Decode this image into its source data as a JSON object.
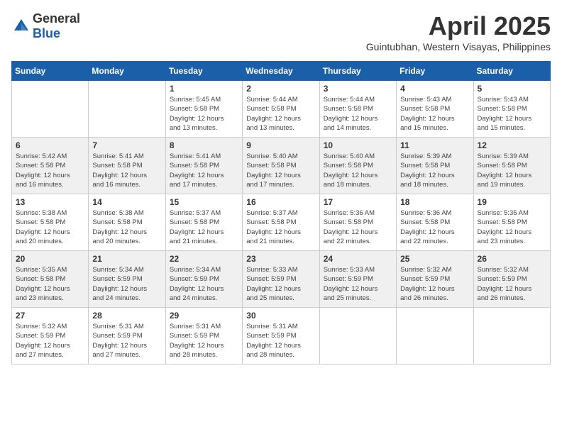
{
  "header": {
    "logo_general": "General",
    "logo_blue": "Blue",
    "month_title": "April 2025",
    "location": "Guintubhan, Western Visayas, Philippines"
  },
  "weekdays": [
    "Sunday",
    "Monday",
    "Tuesday",
    "Wednesday",
    "Thursday",
    "Friday",
    "Saturday"
  ],
  "weeks": [
    [
      {
        "day": "",
        "info": ""
      },
      {
        "day": "",
        "info": ""
      },
      {
        "day": "1",
        "info": "Sunrise: 5:45 AM\nSunset: 5:58 PM\nDaylight: 12 hours\nand 13 minutes."
      },
      {
        "day": "2",
        "info": "Sunrise: 5:44 AM\nSunset: 5:58 PM\nDaylight: 12 hours\nand 13 minutes."
      },
      {
        "day": "3",
        "info": "Sunrise: 5:44 AM\nSunset: 5:58 PM\nDaylight: 12 hours\nand 14 minutes."
      },
      {
        "day": "4",
        "info": "Sunrise: 5:43 AM\nSunset: 5:58 PM\nDaylight: 12 hours\nand 15 minutes."
      },
      {
        "day": "5",
        "info": "Sunrise: 5:43 AM\nSunset: 5:58 PM\nDaylight: 12 hours\nand 15 minutes."
      }
    ],
    [
      {
        "day": "6",
        "info": "Sunrise: 5:42 AM\nSunset: 5:58 PM\nDaylight: 12 hours\nand 16 minutes."
      },
      {
        "day": "7",
        "info": "Sunrise: 5:41 AM\nSunset: 5:58 PM\nDaylight: 12 hours\nand 16 minutes."
      },
      {
        "day": "8",
        "info": "Sunrise: 5:41 AM\nSunset: 5:58 PM\nDaylight: 12 hours\nand 17 minutes."
      },
      {
        "day": "9",
        "info": "Sunrise: 5:40 AM\nSunset: 5:58 PM\nDaylight: 12 hours\nand 17 minutes."
      },
      {
        "day": "10",
        "info": "Sunrise: 5:40 AM\nSunset: 5:58 PM\nDaylight: 12 hours\nand 18 minutes."
      },
      {
        "day": "11",
        "info": "Sunrise: 5:39 AM\nSunset: 5:58 PM\nDaylight: 12 hours\nand 18 minutes."
      },
      {
        "day": "12",
        "info": "Sunrise: 5:39 AM\nSunset: 5:58 PM\nDaylight: 12 hours\nand 19 minutes."
      }
    ],
    [
      {
        "day": "13",
        "info": "Sunrise: 5:38 AM\nSunset: 5:58 PM\nDaylight: 12 hours\nand 20 minutes."
      },
      {
        "day": "14",
        "info": "Sunrise: 5:38 AM\nSunset: 5:58 PM\nDaylight: 12 hours\nand 20 minutes."
      },
      {
        "day": "15",
        "info": "Sunrise: 5:37 AM\nSunset: 5:58 PM\nDaylight: 12 hours\nand 21 minutes."
      },
      {
        "day": "16",
        "info": "Sunrise: 5:37 AM\nSunset: 5:58 PM\nDaylight: 12 hours\nand 21 minutes."
      },
      {
        "day": "17",
        "info": "Sunrise: 5:36 AM\nSunset: 5:58 PM\nDaylight: 12 hours\nand 22 minutes."
      },
      {
        "day": "18",
        "info": "Sunrise: 5:36 AM\nSunset: 5:58 PM\nDaylight: 12 hours\nand 22 minutes."
      },
      {
        "day": "19",
        "info": "Sunrise: 5:35 AM\nSunset: 5:58 PM\nDaylight: 12 hours\nand 23 minutes."
      }
    ],
    [
      {
        "day": "20",
        "info": "Sunrise: 5:35 AM\nSunset: 5:58 PM\nDaylight: 12 hours\nand 23 minutes."
      },
      {
        "day": "21",
        "info": "Sunrise: 5:34 AM\nSunset: 5:59 PM\nDaylight: 12 hours\nand 24 minutes."
      },
      {
        "day": "22",
        "info": "Sunrise: 5:34 AM\nSunset: 5:59 PM\nDaylight: 12 hours\nand 24 minutes."
      },
      {
        "day": "23",
        "info": "Sunrise: 5:33 AM\nSunset: 5:59 PM\nDaylight: 12 hours\nand 25 minutes."
      },
      {
        "day": "24",
        "info": "Sunrise: 5:33 AM\nSunset: 5:59 PM\nDaylight: 12 hours\nand 25 minutes."
      },
      {
        "day": "25",
        "info": "Sunrise: 5:32 AM\nSunset: 5:59 PM\nDaylight: 12 hours\nand 26 minutes."
      },
      {
        "day": "26",
        "info": "Sunrise: 5:32 AM\nSunset: 5:59 PM\nDaylight: 12 hours\nand 26 minutes."
      }
    ],
    [
      {
        "day": "27",
        "info": "Sunrise: 5:32 AM\nSunset: 5:59 PM\nDaylight: 12 hours\nand 27 minutes."
      },
      {
        "day": "28",
        "info": "Sunrise: 5:31 AM\nSunset: 5:59 PM\nDaylight: 12 hours\nand 27 minutes."
      },
      {
        "day": "29",
        "info": "Sunrise: 5:31 AM\nSunset: 5:59 PM\nDaylight: 12 hours\nand 28 minutes."
      },
      {
        "day": "30",
        "info": "Sunrise: 5:31 AM\nSunset: 5:59 PM\nDaylight: 12 hours\nand 28 minutes."
      },
      {
        "day": "",
        "info": ""
      },
      {
        "day": "",
        "info": ""
      },
      {
        "day": "",
        "info": ""
      }
    ]
  ],
  "row_shading": [
    false,
    true,
    false,
    true,
    false
  ]
}
